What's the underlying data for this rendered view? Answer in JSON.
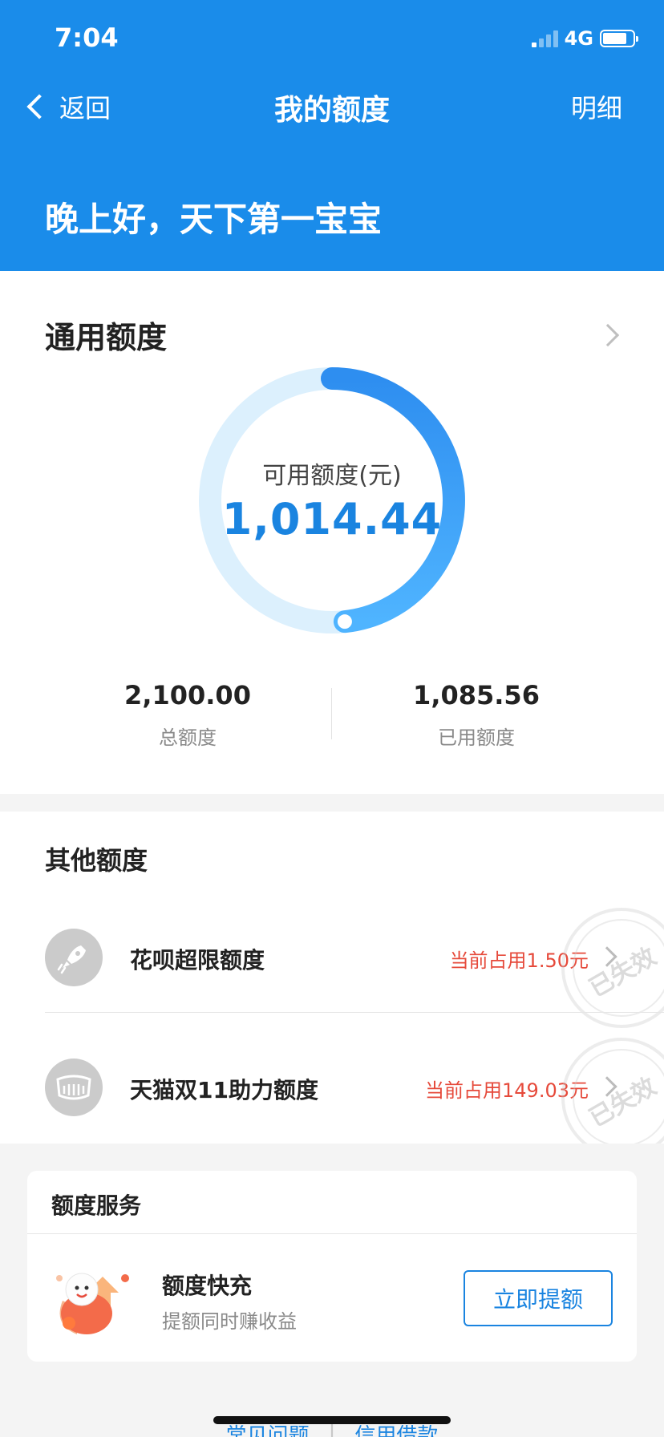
{
  "status": {
    "time": "7:04",
    "network": "4G"
  },
  "nav": {
    "back_label": "返回",
    "title": "我的额度",
    "detail_label": "明细"
  },
  "greeting": "晚上好，天下第一宝宝",
  "general": {
    "title": "通用额度",
    "available_label": "可用额度(元)",
    "available_value": "1,014.44",
    "used_fraction": 0.4833,
    "total_value": "2,100.00",
    "total_label": "总额度",
    "used_value": "1,085.56",
    "used_label": "已用额度"
  },
  "other": {
    "title": "其他额度",
    "items": [
      {
        "name": "花呗超限额度",
        "used": "当前占用1.50元",
        "stamp": "已失效",
        "icon": "rocket-icon"
      },
      {
        "name": "天猫双11助力额度",
        "used": "当前占用149.03元",
        "stamp": "已失效",
        "icon": "cat-icon"
      }
    ]
  },
  "service": {
    "title": "额度服务",
    "item_name": "额度快充",
    "item_desc": "提额同时赚收益",
    "button_label": "立即提额"
  },
  "footer": {
    "links": [
      "常见问题",
      "信用借款"
    ]
  },
  "colors": {
    "brand_blue": "#1a8cea",
    "accent_red": "#e64a3b",
    "ring_track": "#dcf0fd"
  }
}
